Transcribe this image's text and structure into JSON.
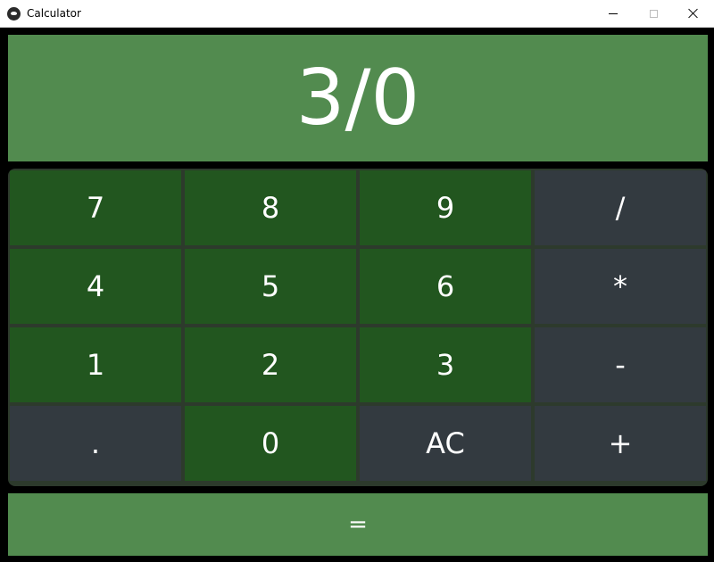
{
  "window": {
    "title": "Calculator"
  },
  "display": {
    "value": "3/0"
  },
  "keys": [
    {
      "label": "7",
      "kind": "num"
    },
    {
      "label": "8",
      "kind": "num"
    },
    {
      "label": "9",
      "kind": "num"
    },
    {
      "label": "/",
      "kind": "op"
    },
    {
      "label": "4",
      "kind": "num"
    },
    {
      "label": "5",
      "kind": "num"
    },
    {
      "label": "6",
      "kind": "num"
    },
    {
      "label": "*",
      "kind": "op"
    },
    {
      "label": "1",
      "kind": "num"
    },
    {
      "label": "2",
      "kind": "num"
    },
    {
      "label": "3",
      "kind": "num"
    },
    {
      "label": "-",
      "kind": "op"
    },
    {
      "label": ".",
      "kind": "op"
    },
    {
      "label": "0",
      "kind": "num"
    },
    {
      "label": "AC",
      "kind": "op"
    },
    {
      "label": "+",
      "kind": "op"
    }
  ],
  "equals": {
    "label": "="
  },
  "colors": {
    "display_bg": "#528b4f",
    "number_key_bg": "#22561f",
    "operator_key_bg": "#333a40",
    "window_bg": "#000000"
  },
  "icons": {
    "app": "app-icon",
    "minimize": "minimize-icon",
    "maximize": "maximize-icon",
    "close": "close-icon"
  }
}
